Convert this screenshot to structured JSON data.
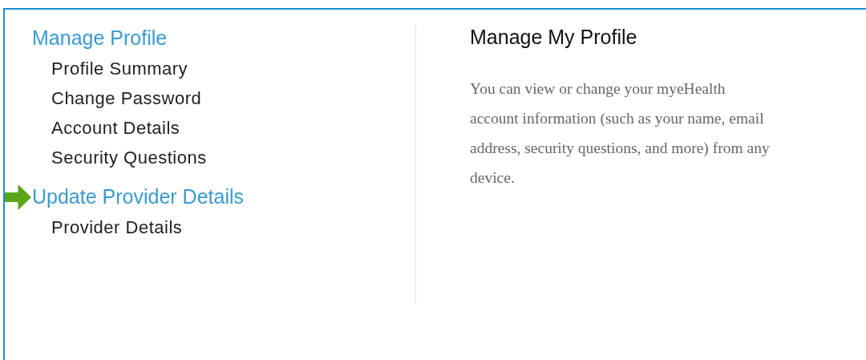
{
  "sections": [
    {
      "heading": "Manage Profile",
      "marked": false,
      "items": [
        "Profile Summary",
        "Change Password",
        "Account Details",
        "Security Questions"
      ]
    },
    {
      "heading": "Update Provider Details",
      "marked": true,
      "items": [
        "Provider Details"
      ]
    }
  ],
  "content": {
    "title": "Manage My Profile",
    "lines": [
      "You can view or change your myeHealth",
      "account information (such as your name, email",
      "address, security questions, and more) from any",
      "device."
    ]
  }
}
